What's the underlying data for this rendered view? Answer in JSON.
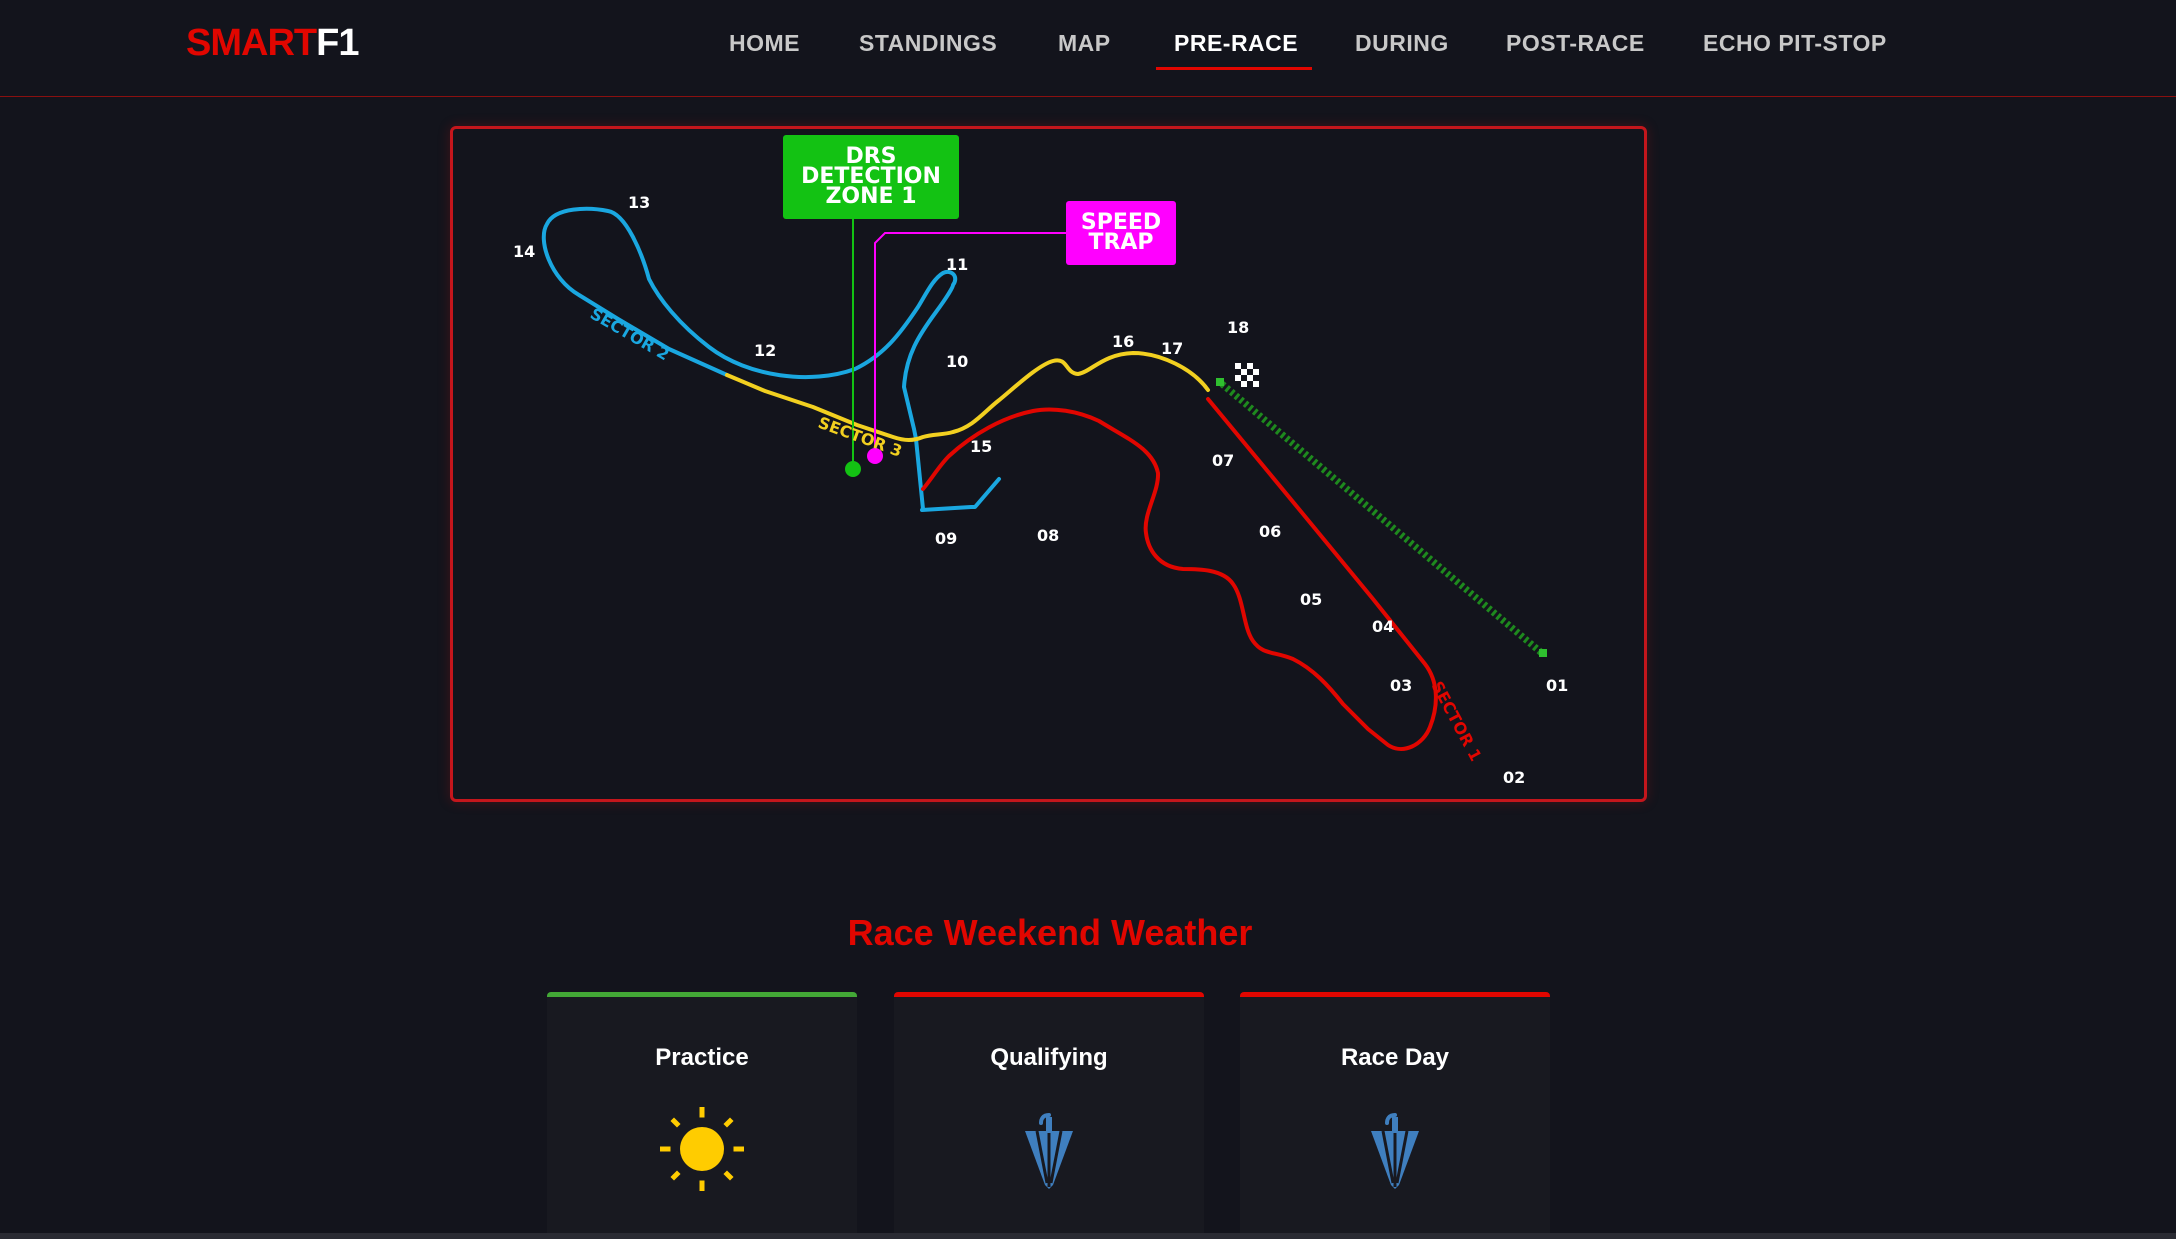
{
  "brand": {
    "part1": "SMART",
    "part2": "F1"
  },
  "nav": {
    "items": [
      {
        "label": "HOME"
      },
      {
        "label": "STANDINGS"
      },
      {
        "label": "MAP"
      },
      {
        "label": "PRE-RACE",
        "active": true
      },
      {
        "label": "DURING"
      },
      {
        "label": "POST-RACE"
      },
      {
        "label": "ECHO PIT-STOP"
      }
    ]
  },
  "track_map": {
    "callouts": {
      "drs": [
        "DRS",
        "DETECTION",
        "ZONE 1"
      ],
      "speed_trap": [
        "SPEED",
        "TRAP"
      ]
    },
    "sectors": {
      "sector1": "SECTOR 1",
      "sector2": "SECTOR 2",
      "sector3": "SECTOR 3"
    },
    "turns": [
      "01",
      "02",
      "03",
      "04",
      "05",
      "06",
      "07",
      "08",
      "09",
      "10",
      "11",
      "12",
      "13",
      "14",
      "15",
      "16",
      "17",
      "18"
    ],
    "colors": {
      "sector1": "#e10600",
      "sector2": "#1aa7e0",
      "sector3": "#f2d020",
      "drs": "#13c213",
      "speed_trap": "#ff00ff",
      "drs_zone": "#1e8a1e"
    }
  },
  "weather": {
    "title": "Race Weekend Weather",
    "cards": [
      {
        "label": "Practice",
        "icon": "sun-icon",
        "status_color": "#43a836"
      },
      {
        "label": "Qualifying",
        "icon": "umbrella-icon",
        "status_color": "#e10600"
      },
      {
        "label": "Race Day",
        "icon": "umbrella-icon",
        "status_color": "#e10600"
      }
    ]
  }
}
